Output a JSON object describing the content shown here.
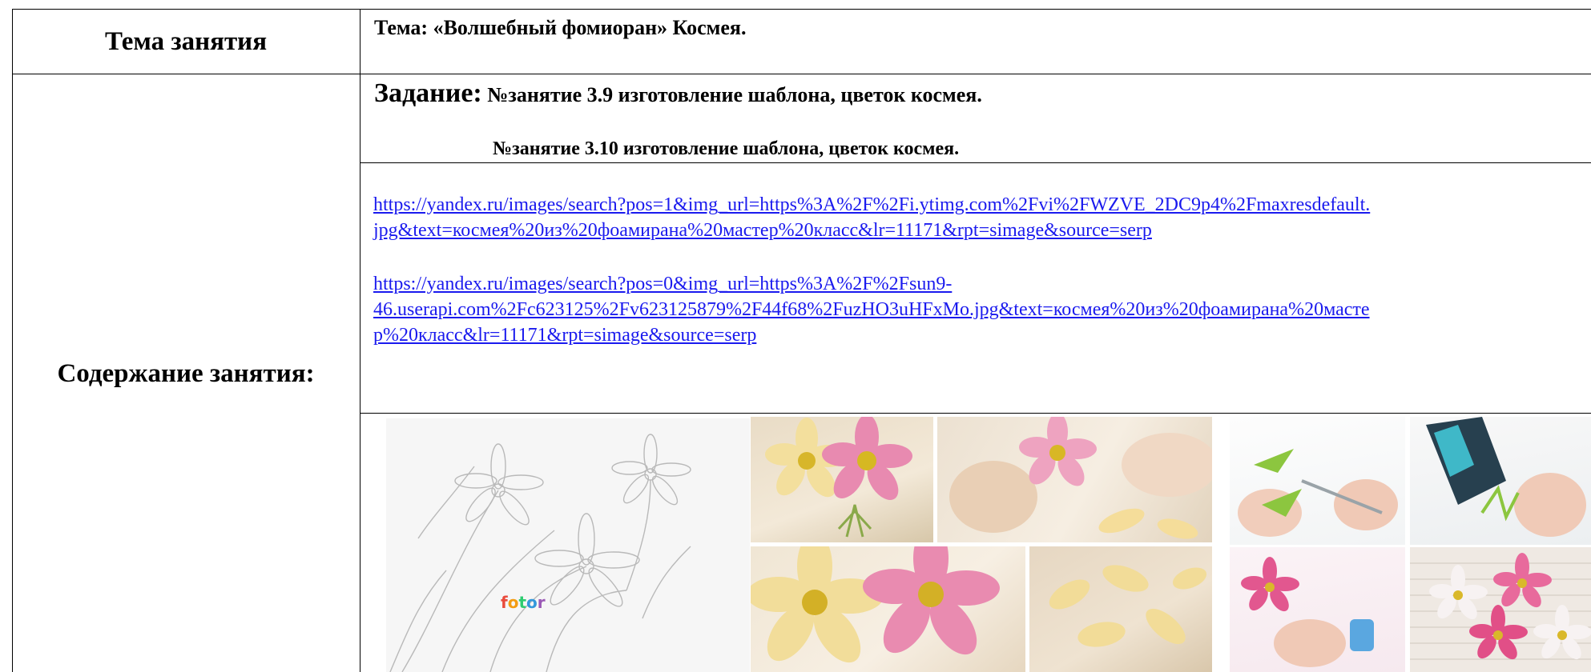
{
  "table": {
    "row1": {
      "label": "Тема занятия",
      "value": "Тема: «Волшебный фомиоран» Космея."
    },
    "row2": {
      "label": "Содержание занятия:",
      "task_prefix": "Задание:",
      "task_line1": " №занятие 3.9 изготовление шаблона, цветок космея.",
      "task_line2": "№занятие 3.10 изготовление шаблона, цветок космея.",
      "links": {
        "link1_line1": "https://yandex.ru/images/search?pos=1&img_url=https%3A%2F%2Fi.ytimg.com%2Fvi%2FWZVE_2DC9p4%2Fmaxresdefault.",
        "link1_line2": "jpg&text=космея%20из%20фоамирана%20мастер%20класс&lr=11171&rpt=simage&source=serp",
        "link2_line1": "https://yandex.ru/images/search?pos=0&img_url=https%3A%2F%2Fsun9-",
        "link2_line2": "46.userapi.com%2Fc623125%2Fv623125879%2F44f68%2FuzHO3uHFxMo.jpg&text=космея%20из%20фоамирана%20масте",
        "link2_line3": "р%20класс&lr=11171&rpt=simage&source=serp"
      },
      "sketch_logo": "fotor"
    }
  }
}
